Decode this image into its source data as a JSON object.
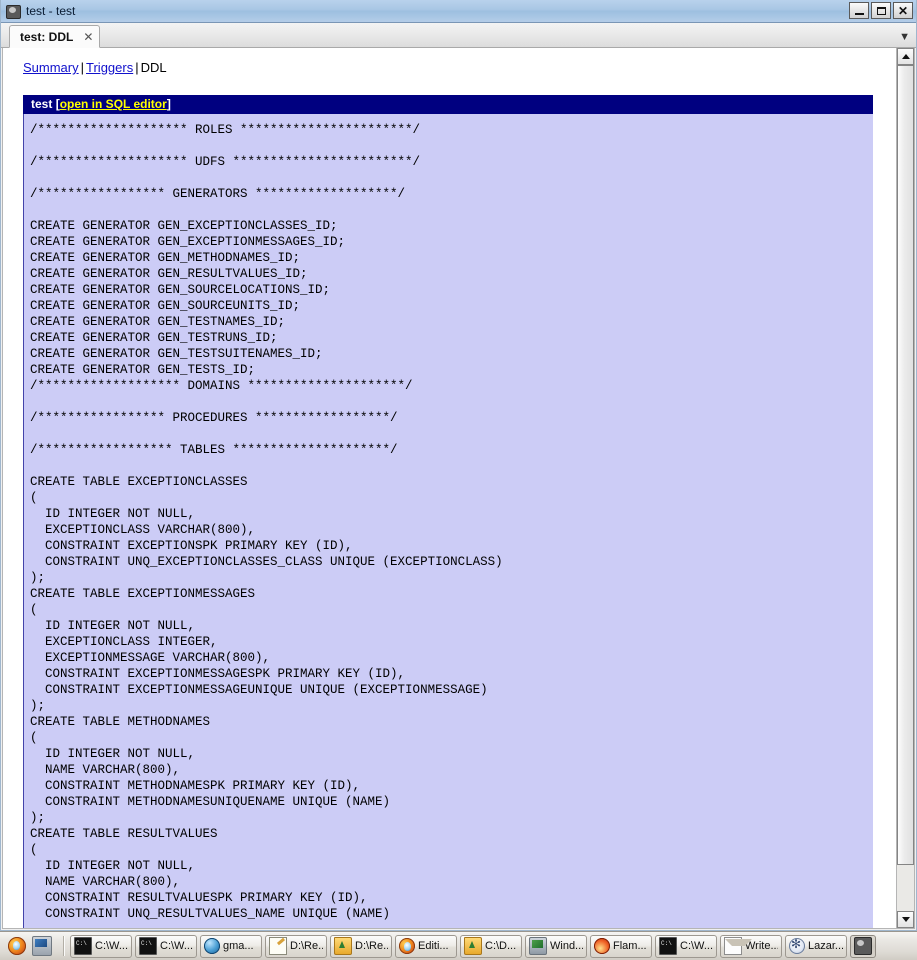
{
  "window": {
    "title": "test - test",
    "icon": "app-icon",
    "controls": {
      "minimize": "_",
      "maximize": "□",
      "close": "✕"
    }
  },
  "tabs": {
    "items": [
      {
        "label": "test: DDL",
        "close": "✕",
        "active": true
      }
    ],
    "overflow": "▼"
  },
  "breadcrumb": {
    "links": [
      {
        "label": "Summary",
        "active": false
      },
      {
        "label": "Triggers",
        "active": false
      }
    ],
    "separator": "|",
    "current": "DDL"
  },
  "object_header": {
    "name": "test",
    "open_bracket": "[",
    "link": "open in SQL editor",
    "close_bracket": "]"
  },
  "ddl": {
    "text": "/******************** ROLES ***********************/\n\n/******************** UDFS ************************/\n\n/***************** GENERATORS *******************/\n\nCREATE GENERATOR GEN_EXCEPTIONCLASSES_ID;\nCREATE GENERATOR GEN_EXCEPTIONMESSAGES_ID;\nCREATE GENERATOR GEN_METHODNAMES_ID;\nCREATE GENERATOR GEN_RESULTVALUES_ID;\nCREATE GENERATOR GEN_SOURCELOCATIONS_ID;\nCREATE GENERATOR GEN_SOURCEUNITS_ID;\nCREATE GENERATOR GEN_TESTNAMES_ID;\nCREATE GENERATOR GEN_TESTRUNS_ID;\nCREATE GENERATOR GEN_TESTSUITENAMES_ID;\nCREATE GENERATOR GEN_TESTS_ID;\n/******************* DOMAINS *********************/\n\n/***************** PROCEDURES ******************/\n\n/****************** TABLES *********************/\n\nCREATE TABLE EXCEPTIONCLASSES\n(\n  ID INTEGER NOT NULL,\n  EXCEPTIONCLASS VARCHAR(800),\n  CONSTRAINT EXCEPTIONSPK PRIMARY KEY (ID),\n  CONSTRAINT UNQ_EXCEPTIONCLASSES_CLASS UNIQUE (EXCEPTIONCLASS)\n);\nCREATE TABLE EXCEPTIONMESSAGES\n(\n  ID INTEGER NOT NULL,\n  EXCEPTIONCLASS INTEGER,\n  EXCEPTIONMESSAGE VARCHAR(800),\n  CONSTRAINT EXCEPTIONMESSAGESPK PRIMARY KEY (ID),\n  CONSTRAINT EXCEPTIONMESSAGEUNIQUE UNIQUE (EXCEPTIONMESSAGE)\n);\nCREATE TABLE METHODNAMES\n(\n  ID INTEGER NOT NULL,\n  NAME VARCHAR(800),\n  CONSTRAINT METHODNAMESPK PRIMARY KEY (ID),\n  CONSTRAINT METHODNAMESUNIQUENAME UNIQUE (NAME)\n);\nCREATE TABLE RESULTVALUES\n(\n  ID INTEGER NOT NULL,\n  NAME VARCHAR(800),\n  CONSTRAINT RESULTVALUESPK PRIMARY KEY (ID),\n  CONSTRAINT UNQ_RESULTVALUES_NAME UNIQUE (NAME)"
  },
  "scrollbar": {
    "up": "▲",
    "down": "▼"
  },
  "taskbar": {
    "quick_launch": [
      {
        "icon": "firefox-icon"
      },
      {
        "icon": "show-desktop-icon"
      }
    ],
    "buttons": [
      {
        "label": "C:\\W...",
        "icon": "command-prompt-icon",
        "active": false
      },
      {
        "label": "C:\\W...",
        "icon": "command-prompt-icon",
        "active": false
      },
      {
        "label": "gma...",
        "icon": "internet-explorer-icon",
        "active": false
      },
      {
        "label": "D:\\Re...",
        "icon": "notepad-icon",
        "active": false
      },
      {
        "label": "D:\\Re...",
        "icon": "folder-icon",
        "active": false
      },
      {
        "label": "Editi...",
        "icon": "firefox-icon",
        "active": false
      },
      {
        "label": "C:\\D...",
        "icon": "folder-icon",
        "active": false
      },
      {
        "label": "Wind...",
        "icon": "monitor-icon",
        "active": false
      },
      {
        "label": "Flam...",
        "icon": "flame-icon",
        "active": false
      },
      {
        "label": "C:\\W...",
        "icon": "command-prompt-icon",
        "active": false
      },
      {
        "label": "Write...",
        "icon": "mail-icon",
        "active": false
      },
      {
        "label": "Lazar...",
        "icon": "lazarus-icon",
        "active": false
      },
      {
        "label": "",
        "icon": "app-icon",
        "active": true
      }
    ]
  },
  "colors": {
    "code_background": "#ccccf6",
    "object_header_background": "#000080",
    "link": "#1111cc",
    "header_link": "#ffff00",
    "titlebar": "#a8c6e4"
  }
}
